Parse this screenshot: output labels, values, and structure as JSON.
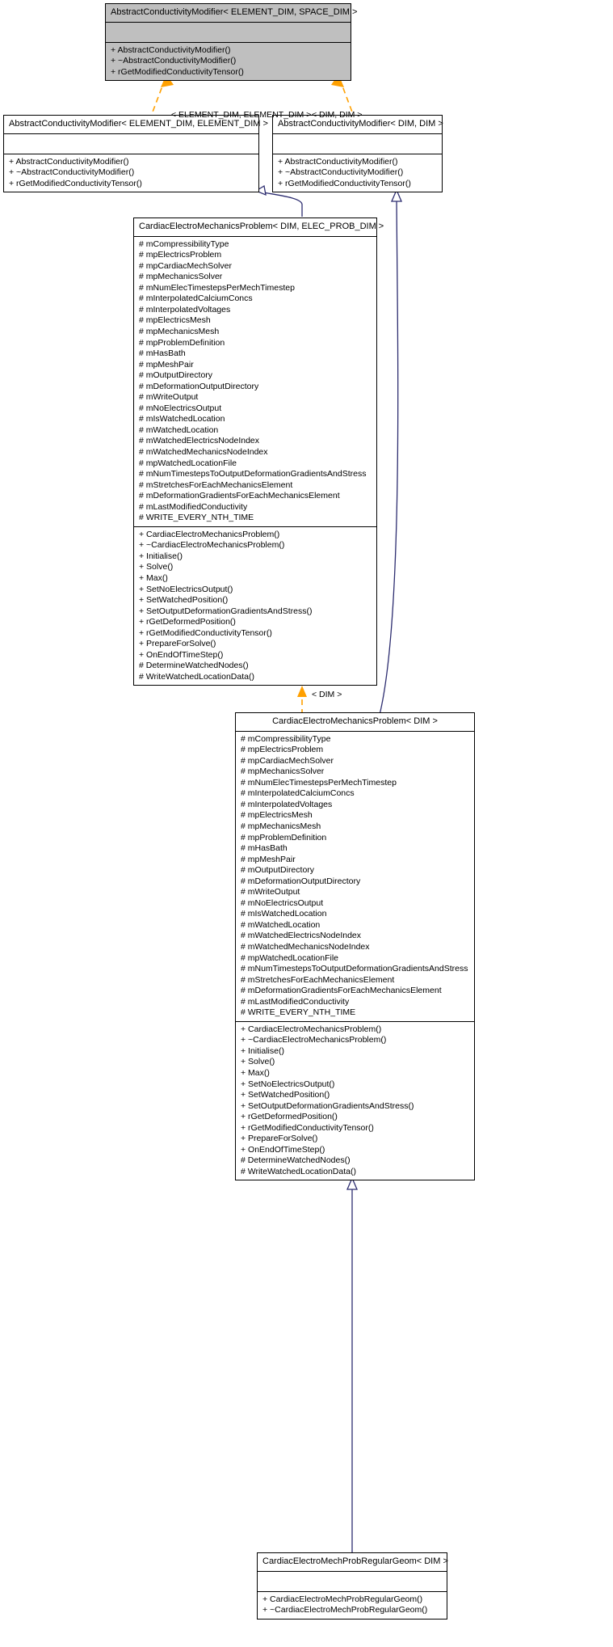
{
  "diagram": {
    "type": "uml-class-inheritance",
    "background_color": "#ffffff",
    "template_edge_color": "#ffa000",
    "inherit_edge_color": "#2d2d70",
    "highlight_fill": "#bfbfbf"
  },
  "nodes": [
    {
      "id": "abstract-conductivity-modifier-element-space",
      "title": "AbstractConductivityModifier< ELEMENT_DIM, SPACE_DIM >",
      "attributes": [],
      "operations": [
        "+ AbstractConductivityModifier()",
        "+ ~AbstractConductivityModifier()",
        "+ rGetModifiedConductivityTensor()"
      ]
    },
    {
      "id": "abstract-conductivity-modifier-element-element",
      "title": "AbstractConductivityModifier< ELEMENT_DIM, ELEMENT_DIM >",
      "attributes": [],
      "operations": [
        "+ AbstractConductivityModifier()",
        "+ ~AbstractConductivityModifier()",
        "+ rGetModifiedConductivityTensor()"
      ]
    },
    {
      "id": "abstract-conductivity-modifier-dim-dim",
      "title": "AbstractConductivityModifier< DIM, DIM >",
      "attributes": [],
      "operations": [
        "+ AbstractConductivityModifier()",
        "+ ~AbstractConductivityModifier()",
        "+ rGetModifiedConductivityTensor()"
      ]
    },
    {
      "id": "cardiac-electro-mechanics-problem-dim-elec-prob-dim",
      "title": "CardiacElectroMechanicsProblem< DIM, ELEC_PROB_DIM >",
      "attributes": [
        "# mCompressibilityType",
        "# mpElectricsProblem",
        "# mpCardiacMechSolver",
        "# mpMechanicsSolver",
        "# mNumElecTimestepsPerMechTimestep",
        "# mInterpolatedCalciumConcs",
        "# mInterpolatedVoltages",
        "# mpElectricsMesh",
        "# mpMechanicsMesh",
        "# mpProblemDefinition",
        "# mHasBath",
        "# mpMeshPair",
        "# mOutputDirectory",
        "# mDeformationOutputDirectory",
        "# mWriteOutput",
        "# mNoElectricsOutput",
        "# mIsWatchedLocation",
        "# mWatchedLocation",
        "# mWatchedElectricsNodeIndex",
        "# mWatchedMechanicsNodeIndex",
        "# mpWatchedLocationFile",
        "# mNumTimestepsToOutputDeformationGradientsAndStress",
        "# mStretchesForEachMechanicsElement",
        "# mDeformationGradientsForEachMechanicsElement",
        "# mLastModifiedConductivity",
        "# WRITE_EVERY_NTH_TIME"
      ],
      "operations": [
        "+ CardiacElectroMechanicsProblem()",
        "+ ~CardiacElectroMechanicsProblem()",
        "+ Initialise()",
        "+ Solve()",
        "+ Max()",
        "+ SetNoElectricsOutput()",
        "+ SetWatchedPosition()",
        "+ SetOutputDeformationGradientsAndStress()",
        "+ rGetDeformedPosition()",
        "+ rGetModifiedConductivityTensor()",
        "+ PrepareForSolve()",
        "+ OnEndOfTimeStep()",
        "# DetermineWatchedNodes()",
        "# WriteWatchedLocationData()"
      ]
    },
    {
      "id": "cardiac-electro-mechanics-problem-dim",
      "title": "CardiacElectroMechanicsProblem< DIM >",
      "attributes": [
        "# mCompressibilityType",
        "# mpElectricsProblem",
        "# mpCardiacMechSolver",
        "# mpMechanicsSolver",
        "# mNumElecTimestepsPerMechTimestep",
        "# mInterpolatedCalciumConcs",
        "# mInterpolatedVoltages",
        "# mpElectricsMesh",
        "# mpMechanicsMesh",
        "# mpProblemDefinition",
        "# mHasBath",
        "# mpMeshPair",
        "# mOutputDirectory",
        "# mDeformationOutputDirectory",
        "# mWriteOutput",
        "# mNoElectricsOutput",
        "# mIsWatchedLocation",
        "# mWatchedLocation",
        "# mWatchedElectricsNodeIndex",
        "# mWatchedMechanicsNodeIndex",
        "# mpWatchedLocationFile",
        "# mNumTimestepsToOutputDeformationGradientsAndStress",
        "# mStretchesForEachMechanicsElement",
        "# mDeformationGradientsForEachMechanicsElement",
        "# mLastModifiedConductivity",
        "# WRITE_EVERY_NTH_TIME"
      ],
      "operations": [
        "+ CardiacElectroMechanicsProblem()",
        "+ ~CardiacElectroMechanicsProblem()",
        "+ Initialise()",
        "+ Solve()",
        "+ Max()",
        "+ SetNoElectricsOutput()",
        "+ SetWatchedPosition()",
        "+ SetOutputDeformationGradientsAndStress()",
        "+ rGetDeformedPosition()",
        "+ rGetModifiedConductivityTensor()",
        "+ PrepareForSolve()",
        "+ OnEndOfTimeStep()",
        "# DetermineWatchedNodes()",
        "# WriteWatchedLocationData()"
      ]
    },
    {
      "id": "cardiac-electro-mech-prob-regular-geom-dim",
      "title": "CardiacElectroMechProbRegularGeom< DIM >",
      "attributes": [],
      "operations": [
        "+ CardiacElectroMechProbRegularGeom()",
        "+ ~CardiacElectroMechProbRegularGeom()"
      ]
    }
  ],
  "edge_labels": [
    {
      "id": "label-element-element",
      "text": "< ELEMENT_DIM, ELEMENT_DIM >"
    },
    {
      "id": "label-dim-dim",
      "text": "< DIM, DIM >"
    },
    {
      "id": "label-dim",
      "text": "< DIM >"
    }
  ]
}
